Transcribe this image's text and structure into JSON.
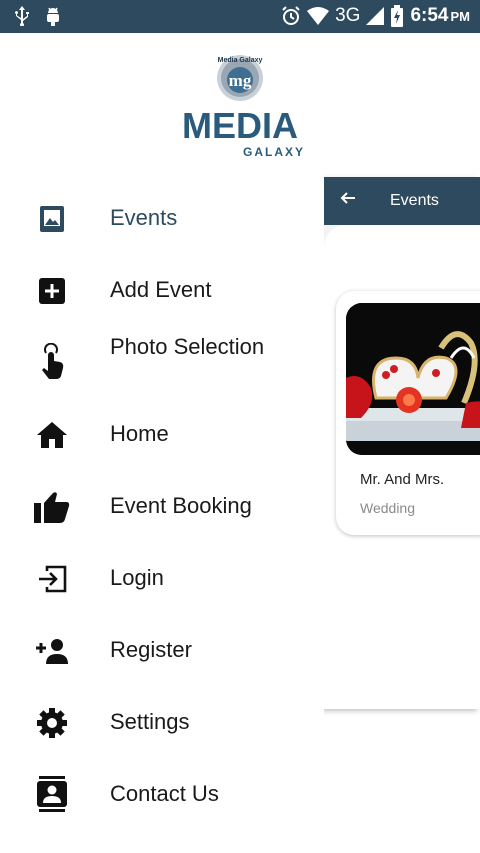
{
  "status_bar": {
    "network": "3G",
    "time": "6:54",
    "ampm": "PM",
    "icons": [
      "usb-icon",
      "android-debug-icon",
      "alarm-icon",
      "wifi-icon",
      "signal-icon",
      "battery-charging-icon"
    ]
  },
  "drawer": {
    "logo": {
      "top_text": "Media Galaxy",
      "monogram": "mg",
      "main_text": "MEDIA",
      "sub_text": "GALAXY"
    },
    "items": [
      {
        "label": "Events",
        "icon": "photo-icon",
        "active": true
      },
      {
        "label": "Add Event",
        "icon": "add-box-icon"
      },
      {
        "label": "Photo Selection",
        "icon": "touch-icon"
      },
      {
        "label": "Home",
        "icon": "home-icon"
      },
      {
        "label": "Event Booking",
        "icon": "thumb-up-icon"
      },
      {
        "label": "Login",
        "icon": "login-icon"
      },
      {
        "label": "Register",
        "icon": "person-add-icon"
      },
      {
        "label": "Settings",
        "icon": "settings-icon"
      },
      {
        "label": "Contact Us",
        "icon": "contacts-icon"
      }
    ]
  },
  "background_screen": {
    "toolbar_title": "Events",
    "event_card": {
      "title": "Mr. And Mrs.",
      "category": "Wedding"
    }
  },
  "colors": {
    "primary": "#2e4a5e",
    "text": "#1a1a1a",
    "muted": "#8a8a8a"
  }
}
